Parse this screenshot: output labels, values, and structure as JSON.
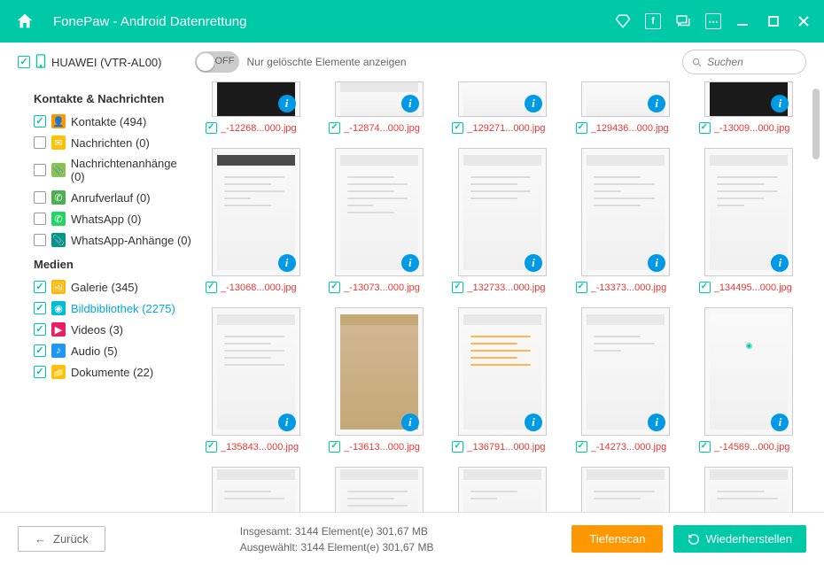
{
  "app": {
    "title": "FonePaw - Android Datenrettung"
  },
  "device": {
    "name": "HUAWEI (VTR-AL00)",
    "checked": true
  },
  "toggle": {
    "state": "OFF",
    "label": "Nur gelöschte Elemente anzeigen"
  },
  "search": {
    "placeholder": "Suchen"
  },
  "sidebar": {
    "section1": "Kontakte & Nachrichten",
    "section2": "Medien",
    "items": [
      {
        "label": "Kontakte (494)",
        "checked": true,
        "icon": "ic-contacts"
      },
      {
        "label": "Nachrichten (0)",
        "checked": false,
        "icon": "ic-msg"
      },
      {
        "label": "Nachrichtenanhänge (0)",
        "checked": false,
        "icon": "ic-attach"
      },
      {
        "label": "Anrufverlauf (0)",
        "checked": false,
        "icon": "ic-call"
      },
      {
        "label": "WhatsApp (0)",
        "checked": false,
        "icon": "ic-wa"
      },
      {
        "label": "WhatsApp-Anhänge (0)",
        "checked": false,
        "icon": "ic-wa2"
      },
      {
        "label": "Galerie (345)",
        "checked": true,
        "icon": "ic-gallery"
      },
      {
        "label": "Bildbibliothek (2275)",
        "checked": true,
        "icon": "ic-imglib",
        "selected": true
      },
      {
        "label": "Videos (3)",
        "checked": true,
        "icon": "ic-video"
      },
      {
        "label": "Audio (5)",
        "checked": true,
        "icon": "ic-audio"
      },
      {
        "label": "Dokumente (22)",
        "checked": true,
        "icon": "ic-doc"
      }
    ]
  },
  "thumbs": {
    "row0": [
      {
        "filename": "_-12268...000.jpg",
        "dark": true
      },
      {
        "filename": "_-12874...000.jpg"
      },
      {
        "filename": "_129271...000.jpg"
      },
      {
        "filename": "_129436...000.jpg"
      },
      {
        "filename": "_-13009...000.jpg",
        "dark": true
      }
    ],
    "row1": [
      {
        "filename": "_-13068...000.jpg"
      },
      {
        "filename": "_-13073...000.jpg"
      },
      {
        "filename": "_132733...000.jpg"
      },
      {
        "filename": "_-13373...000.jpg"
      },
      {
        "filename": "_134495...000.jpg"
      }
    ],
    "row2": [
      {
        "filename": "_135843...000.jpg"
      },
      {
        "filename": "_-13613...000.jpg"
      },
      {
        "filename": "_136791...000.jpg"
      },
      {
        "filename": "_-14273...000.jpg"
      },
      {
        "filename": "_-14569...000.jpg"
      }
    ]
  },
  "footer": {
    "back": "Zurück",
    "total_label": "Insgesamt: 3144 Element(e) 301,67 MB",
    "selected_label": "Ausgewählt: 3144 Element(e) 301,67 MB",
    "deepscan": "Tiefenscan",
    "recover": "Wiederherstellen"
  }
}
